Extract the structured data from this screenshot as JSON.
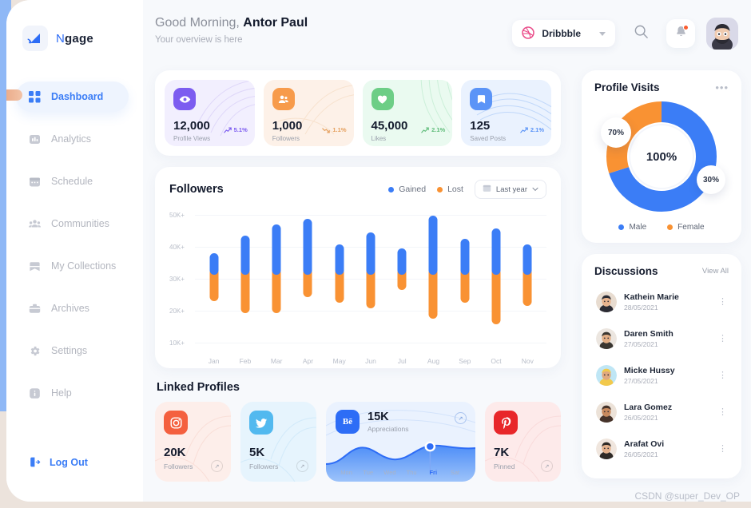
{
  "brand": {
    "name_light": "N",
    "name_bold": "gage",
    "logo_icon": "cast-signal-icon"
  },
  "sidebar": {
    "items": [
      {
        "label": "Dashboard",
        "icon": "grid-icon",
        "active": true
      },
      {
        "label": "Analytics",
        "icon": "bar-chart-icon",
        "active": false
      },
      {
        "label": "Schedule",
        "icon": "calendar-icon",
        "active": false
      },
      {
        "label": "Communities",
        "icon": "people-group-icon",
        "active": false
      },
      {
        "label": "My Collections",
        "icon": "bookmark-icon",
        "active": false
      },
      {
        "label": "Archives",
        "icon": "briefcase-icon",
        "active": false
      },
      {
        "label": "Settings",
        "icon": "gear-icon",
        "active": false
      },
      {
        "label": "Help",
        "icon": "info-icon",
        "active": false
      }
    ],
    "logout_label": "Log Out",
    "logout_icon": "logout-icon"
  },
  "header": {
    "greeting_prefix": "Good Morning, ",
    "user_name": "Antor Paul",
    "subtitle": "Your overview is here",
    "source_pill": {
      "label": "Dribbble",
      "icon": "dribbble-icon",
      "caret": "chevron-down-icon"
    },
    "search_icon": "search-icon",
    "bell_icon": "bell-icon",
    "avatar": "user-avatar"
  },
  "stats": [
    {
      "value": "12,000",
      "label": "Profile Views",
      "pct": "5.1%",
      "trend": "up",
      "icon": "eye-icon",
      "accent": "#7c5cf0",
      "bg": "#f0edfe"
    },
    {
      "value": "1,000",
      "label": "Followers",
      "pct": "1.1%",
      "trend": "down",
      "icon": "people-icon",
      "accent": "#f79b4b",
      "bg": "#fdf0e6"
    },
    {
      "value": "45,000",
      "label": "Likes",
      "pct": "2.1%",
      "trend": "up",
      "icon": "heart-icon",
      "accent": "#6dce86",
      "bg": "#eafaf0"
    },
    {
      "value": "125",
      "label": "Saved Posts",
      "pct": "2.1%",
      "trend": "up",
      "icon": "bookmark-icon",
      "accent": "#5b94f7",
      "bg": "#e9f1fe"
    }
  ],
  "followers_chart": {
    "title": "Followers",
    "legend": [
      {
        "label": "Gained",
        "color": "#3b7df6"
      },
      {
        "label": "Lost",
        "color": "#f99233"
      }
    ],
    "range_label": "Last year",
    "range_icon": "calendar-icon",
    "caret_icon": "chevron-down-icon"
  },
  "chart_data": {
    "type": "bar",
    "title": "Followers",
    "xlabel": "",
    "ylabel": "",
    "ylim": [
      5000,
      53000
    ],
    "yticks": [
      10000,
      20000,
      30000,
      40000,
      50000
    ],
    "ytick_labels": [
      "10K+",
      "20K+",
      "30K+",
      "40K+",
      "50K+"
    ],
    "grid": true,
    "legend_position": "top-right",
    "stacked": true,
    "split_value": 32000,
    "categories": [
      "Jan",
      "Feb",
      "Mar",
      "Apr",
      "May",
      "Jun",
      "Jul",
      "Aug",
      "Sep",
      "Oct",
      "Nov"
    ],
    "series": [
      {
        "name": "Gained",
        "color": "#3b7df6",
        "values": [
          37500,
          43500,
          47500,
          49500,
          40500,
          44500,
          39000,
          50500,
          42500,
          46000,
          40500
        ]
      },
      {
        "name": "Lost",
        "color": "#f99233",
        "values": [
          20500,
          16500,
          16500,
          22000,
          20000,
          18000,
          24500,
          14500,
          20000,
          12500,
          19000
        ]
      }
    ]
  },
  "linked_profiles": {
    "title": "Linked Profiles",
    "cards": [
      {
        "kind": "simple",
        "network": "instagram",
        "icon": "instagram-icon",
        "value": "20K",
        "label": "Followers",
        "bg": "#fdeeea",
        "icon_bg": "#f4603f"
      },
      {
        "kind": "simple",
        "network": "twitter",
        "icon": "twitter-icon",
        "value": "5K",
        "label": "Followers",
        "bg": "#e6f4fd",
        "icon_bg": "#52b9ef"
      },
      {
        "kind": "chart",
        "network": "behance",
        "icon": "behance-icon",
        "value": "15K",
        "label": "Appreciations",
        "bg": "#eaf2fe",
        "icon_bg": "#2e6df6",
        "days": [
          "Mon",
          "Tue",
          "Wed",
          "Thu",
          "Fri",
          "Sat"
        ],
        "active_day": "Fri"
      },
      {
        "kind": "simple",
        "network": "pinterest",
        "icon": "pinterest-icon",
        "value": "7K",
        "label": "Pinned",
        "bg": "#fdeaea",
        "icon_bg": "#e8272a"
      }
    ],
    "expand_icon": "arrow-up-right-icon"
  },
  "profile_visits": {
    "title": "Profile Visits",
    "menu_icon": "more-horizontal-icon",
    "center_label": "100%",
    "bubbles": [
      {
        "label": "70%"
      },
      {
        "label": "30%"
      }
    ],
    "segments": [
      {
        "name": "Male",
        "value": 70,
        "color": "#3b7df6"
      },
      {
        "name": "Female",
        "value": 30,
        "color": "#f99233"
      }
    ]
  },
  "discussions": {
    "title": "Discussions",
    "view_all": "View All",
    "kebab_icon": "more-vertical-icon",
    "items": [
      {
        "name": "Kathein Marie",
        "date": "28/05/2021",
        "avatar_bg": "#e8dcd0",
        "skin": "#e8b48e",
        "hair": "#2b2b33"
      },
      {
        "name": "Daren Smith",
        "date": "27/05/2021",
        "avatar_bg": "#ece6e0",
        "skin": "#e2ae85",
        "hair": "#3a3630"
      },
      {
        "name": "Micke Hussy",
        "date": "27/05/2021",
        "avatar_bg": "#bfe6f5",
        "skin": "#e0a97f",
        "hair": "#f2c94c"
      },
      {
        "name": "Lara Gomez",
        "date": "26/05/2021",
        "avatar_bg": "#ece2d8",
        "skin": "#c98a5e",
        "hair": "#46332a"
      },
      {
        "name": "Arafat Ovi",
        "date": "26/05/2021",
        "avatar_bg": "#f0e6de",
        "skin": "#e4b18c",
        "hair": "#2f2a26"
      }
    ]
  },
  "watermark": "CSDN @super_Dev_OP"
}
